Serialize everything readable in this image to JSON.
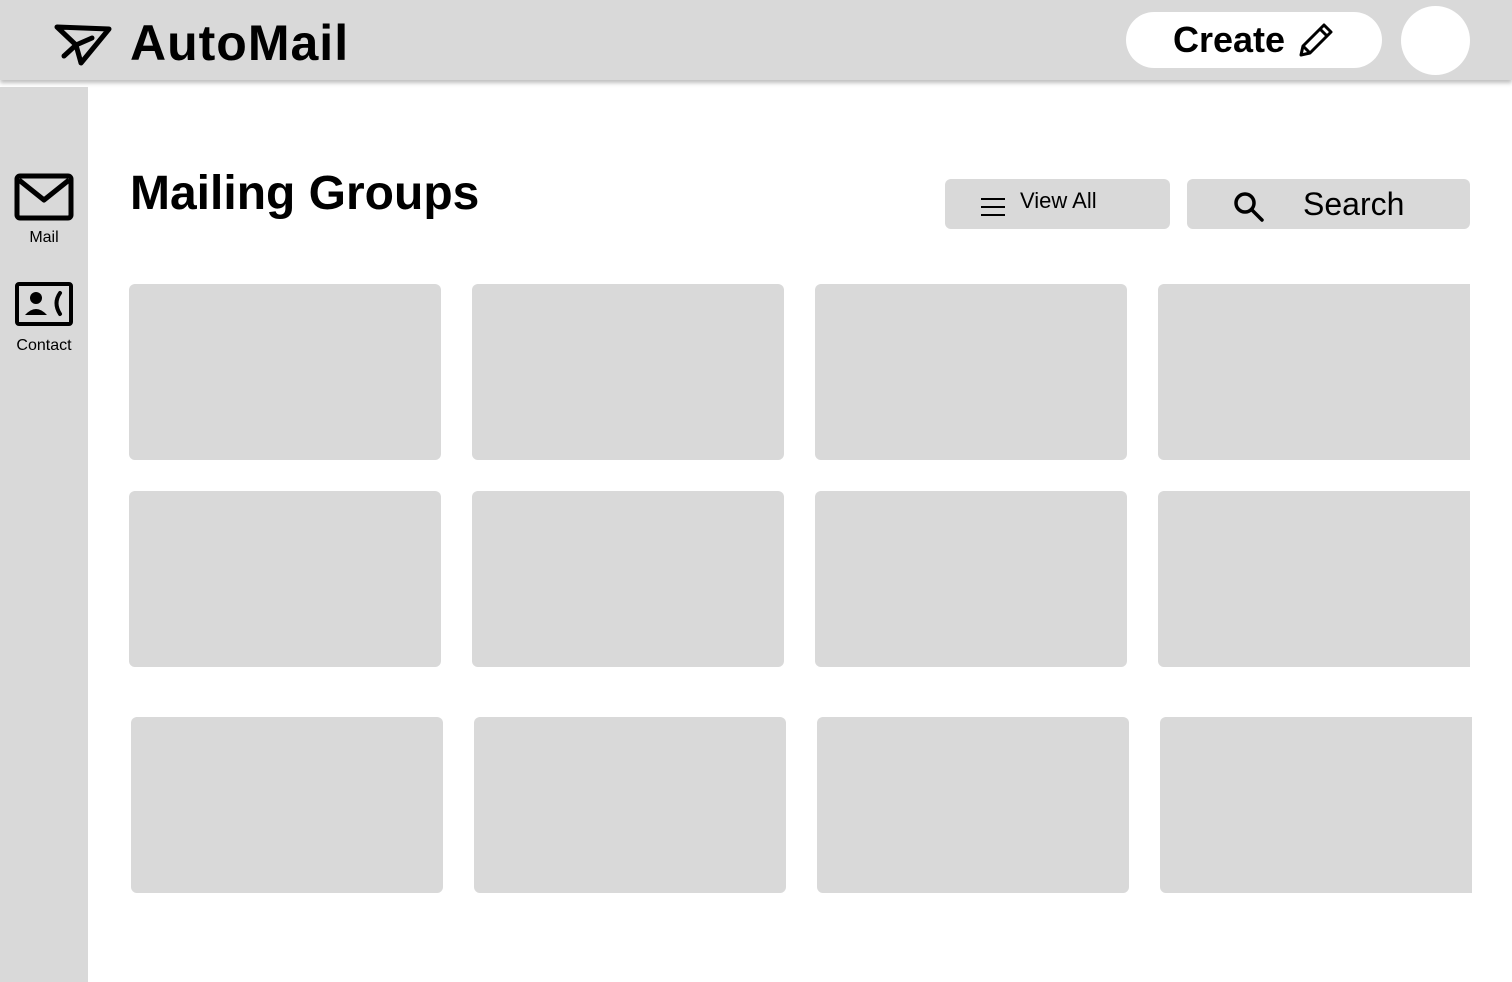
{
  "app": {
    "title": "AutoMail",
    "logo_icon": "paper-plane-icon"
  },
  "header": {
    "create_label": "Create",
    "create_icon": "pencil-icon"
  },
  "sidebar": {
    "items": [
      {
        "label": "Mail",
        "icon": "envelope-icon"
      },
      {
        "label": "Contact",
        "icon": "contact-card-icon"
      }
    ]
  },
  "main": {
    "title": "Mailing Groups",
    "view_all_label": "View All",
    "search_label": "Search"
  },
  "colors": {
    "panel": "#d9d9d9",
    "background": "#ffffff",
    "text": "#000000"
  }
}
